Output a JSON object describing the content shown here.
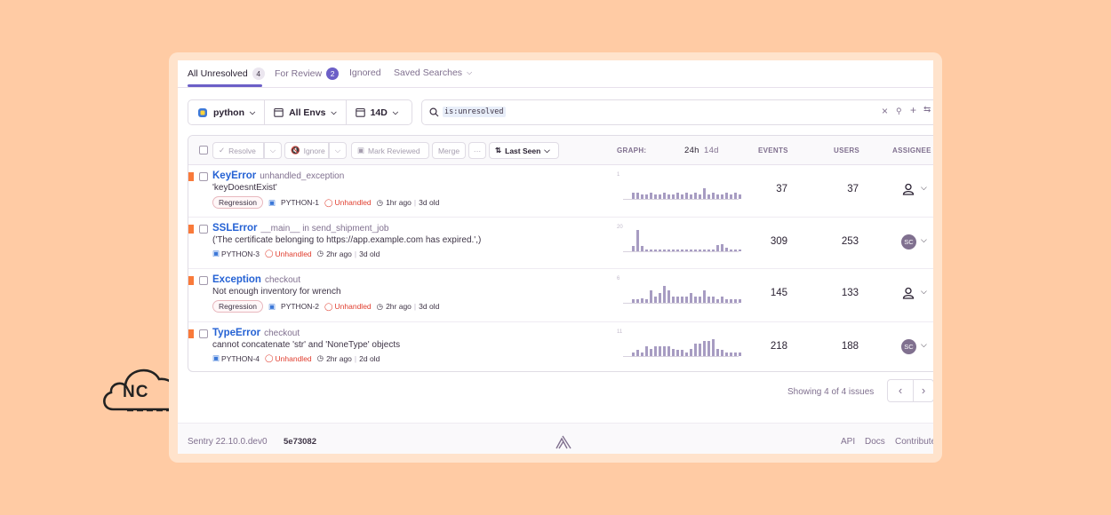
{
  "tabs": [
    {
      "label": "All Unresolved",
      "count": "4"
    },
    {
      "label": "For Review",
      "count": "2"
    },
    {
      "label": "Ignored"
    },
    {
      "label": "Saved Searches"
    }
  ],
  "filters": {
    "project": "python",
    "environment": "All Envs",
    "period": "14D"
  },
  "search": {
    "query": "is:unresolved"
  },
  "toolbar": {
    "resolve": "Resolve",
    "ignore": "Ignore",
    "mark_reviewed": "Mark Reviewed",
    "merge": "Merge",
    "more": "···",
    "sort": "Last Seen"
  },
  "columns": {
    "graph": "GRAPH:",
    "period_24h": "24h",
    "period_14d": "14d",
    "events": "EVENTS",
    "users": "USERS",
    "assignee": "ASSIGNEE"
  },
  "issues": [
    {
      "type": "KeyError",
      "location": "unhandled_exception",
      "message": "'keyDoesntExist'",
      "badge": "Regression",
      "short_id": "PYTHON-1",
      "handled": "Unhandled",
      "last_seen": "1hr ago",
      "age": "3d old",
      "graph_max": "1",
      "events": "37",
      "users": "37",
      "assignee": "",
      "bars": [
        0.3,
        0.3,
        0.2,
        0.2,
        0.3,
        0.2,
        0.2,
        0.3,
        0.2,
        0.2,
        0.3,
        0.2,
        0.3,
        0.2,
        0.3,
        0.2,
        0.5,
        0.2,
        0.3,
        0.2,
        0.2,
        0.3,
        0.2,
        0.3,
        0.2
      ]
    },
    {
      "type": "SSLError",
      "location": "__main__ in send_shipment_job",
      "message": "('The certificate belonging to https://app.example.com has expired.',)",
      "badge": "",
      "short_id": "PYTHON-3",
      "handled": "Unhandled",
      "last_seen": "2hr ago",
      "age": "3d old",
      "graph_max": "20",
      "events": "309",
      "users": "253",
      "assignee": "SC",
      "bars": [
        0.25,
        1.0,
        0.25,
        0.1,
        0.1,
        0.1,
        0.1,
        0.1,
        0.1,
        0.1,
        0.1,
        0.1,
        0.1,
        0.1,
        0.1,
        0.1,
        0.1,
        0.1,
        0.1,
        0.3,
        0.35,
        0.15,
        0.1,
        0.1,
        0.1
      ]
    },
    {
      "type": "Exception",
      "location": "checkout",
      "message": "Not enough inventory for wrench",
      "badge": "Regression",
      "short_id": "PYTHON-2",
      "handled": "Unhandled",
      "last_seen": "2hr ago",
      "age": "3d old",
      "graph_max": "6",
      "events": "145",
      "users": "133",
      "assignee": "",
      "bars": [
        0.15,
        0.15,
        0.2,
        0.15,
        0.6,
        0.3,
        0.45,
        0.8,
        0.6,
        0.3,
        0.3,
        0.3,
        0.3,
        0.45,
        0.3,
        0.3,
        0.6,
        0.3,
        0.3,
        0.15,
        0.3,
        0.15,
        0.15,
        0.15,
        0.15
      ]
    },
    {
      "type": "TypeError",
      "location": "checkout",
      "message": "cannot concatenate 'str' and 'NoneType' objects",
      "badge": "",
      "short_id": "PYTHON-4",
      "handled": "Unhandled",
      "last_seen": "2hr ago",
      "age": "2d old",
      "graph_max": "11",
      "events": "218",
      "users": "188",
      "assignee": "SC",
      "bars": [
        0.15,
        0.3,
        0.15,
        0.45,
        0.35,
        0.45,
        0.45,
        0.45,
        0.45,
        0.35,
        0.3,
        0.3,
        0.15,
        0.35,
        0.6,
        0.6,
        0.7,
        0.7,
        0.8,
        0.35,
        0.3,
        0.15,
        0.15,
        0.15,
        0.15
      ]
    }
  ],
  "pagination": {
    "text": "Showing 4 of 4 issues",
    "prev": "‹",
    "next": "›"
  },
  "footer": {
    "version": "Sentry 22.10.0.dev0",
    "commit": "5e73082",
    "api": "API",
    "docs": "Docs",
    "contribute": "Contribute"
  },
  "logo": {
    "text": "NC"
  }
}
